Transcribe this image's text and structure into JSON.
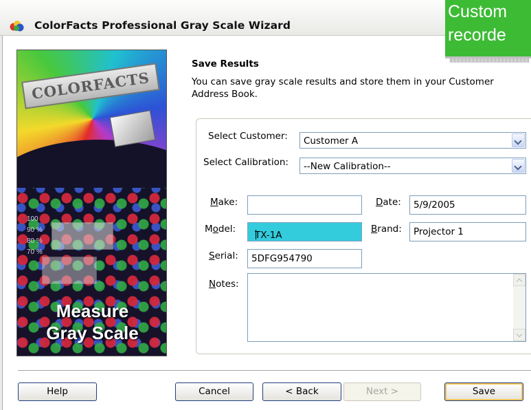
{
  "window": {
    "title": "ColorFacts Professional Gray Scale Wizard"
  },
  "callout": {
    "line1": "Custom",
    "line2": "recorde"
  },
  "banner": {
    "logo": "COLORFACTS",
    "percent_labels": [
      "100",
      "90 %",
      "80 %",
      "70 %"
    ],
    "caption_line1": "Measure",
    "caption_line2": "Gray Scale"
  },
  "section": {
    "title": "Save Results",
    "description": "You can save gray scale results and store them in your Customer Address Book."
  },
  "form": {
    "customer_label": "Select Customer:",
    "customer_value": "Customer A",
    "calibration_label": "Select Calibration:",
    "calibration_value": "--New Calibration--",
    "make_label_accel": "M",
    "make_label_rest": "ake:",
    "make_value": "",
    "date_label_accel": "D",
    "date_label_rest": "ate:",
    "date_value": "5/9/2005",
    "model_label_pre": "M",
    "model_label_accel": "o",
    "model_label_rest": "del:",
    "model_value": "TX-1A",
    "brand_label_accel": "B",
    "brand_label_rest": "rand:",
    "brand_value": "Projector 1",
    "serial_label_accel": "S",
    "serial_label_rest": "erial:",
    "serial_value": "5DFG954790",
    "notes_label_accel": "N",
    "notes_label_rest": "otes:",
    "notes_value": ""
  },
  "buttons": {
    "help": "Help",
    "cancel": "Cancel",
    "back": "< Back",
    "next": "Next >",
    "save": "Save"
  },
  "colors": {
    "callout": "#3dbb35",
    "selected_field": "#33ccdd"
  }
}
